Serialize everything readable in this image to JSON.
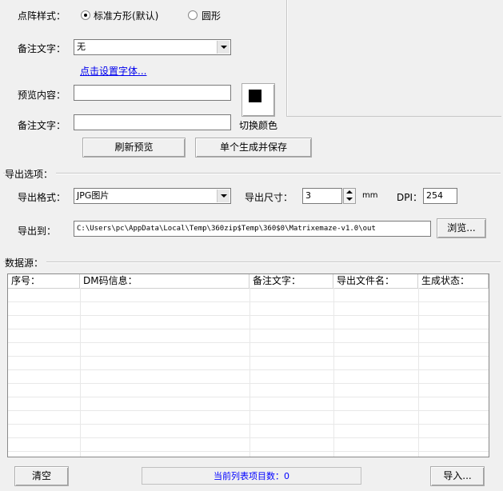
{
  "style": {
    "label": "点阵样式：",
    "opt_square": "标准方形(默认)",
    "opt_circle": "圆形"
  },
  "note1": {
    "label": "备注文字：",
    "value": "无"
  },
  "font_link": "点击设置字体...",
  "preview": {
    "label": "预览内容：",
    "value": ""
  },
  "note2": {
    "label": "备注文字：",
    "value": ""
  },
  "color_btn_label": "切换颜色",
  "refresh_btn": "刷新预览",
  "gen_save_btn": "单个生成并保存",
  "export_section": {
    "title": "导出选项：",
    "format_label": "导出格式：",
    "format_value": "JPG图片",
    "size_label": "导出尺寸：",
    "size_value": "3",
    "size_unit": "mm",
    "dpi_label": "DPI：",
    "dpi_value": "254",
    "path_label": "导出到：",
    "path_value": "C:\\Users\\pc\\AppData\\Local\\Temp\\360zip$Temp\\360$0\\Matrixemaze-v1.0\\out",
    "browse_btn": "浏览..."
  },
  "data_section": {
    "title": "数据源：",
    "columns": [
      "序号：",
      "DM码信息：",
      "备注文字：",
      "导出文件名：",
      "生成状态："
    ]
  },
  "footer": {
    "clear_btn": "清空",
    "status": "当前列表项目数：0",
    "import_btn": "导入..."
  },
  "colors": {
    "link": "#0000ee",
    "status_text": "#0000ff"
  }
}
